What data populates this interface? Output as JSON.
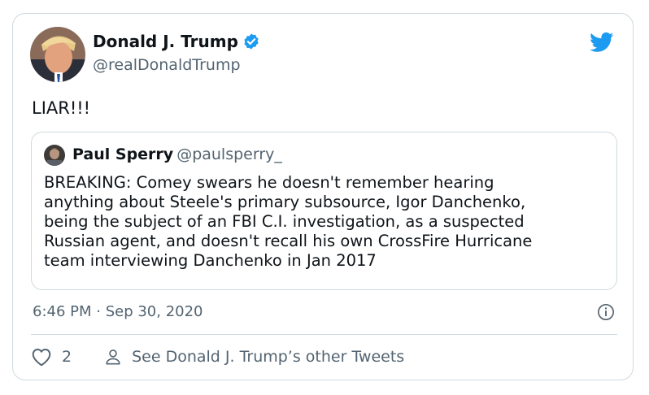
{
  "author": {
    "name": "Donald J. Trump",
    "handle": "@realDonaldTrump"
  },
  "tweet": {
    "text": "LIAR!!!",
    "timestamp": "6:46 PM · Sep 30, 2020"
  },
  "quoted": {
    "name": "Paul Sperry",
    "handle": "@paulsperry_",
    "text": "BREAKING: Comey swears he doesn't remember hearing\nanything about Steele's primary subsource, Igor Danchenko,\nbeing the subject of an FBI C.I. investigation, as a suspected\nRussian agent, and doesn't recall his own CrossFire Hurricane\nteam interviewing Danchenko in Jan 2017"
  },
  "actions": {
    "like_count": "2",
    "other_tweets_label": "See Donald J. Trump’s other Tweets"
  },
  "colors": {
    "accent": "#1d9bf0",
    "muted_text": "#536471",
    "border": "#cfd9de"
  },
  "icons": [
    "verified-badge-icon",
    "twitter-bird-icon",
    "info-icon",
    "heart-icon",
    "person-icon"
  ]
}
